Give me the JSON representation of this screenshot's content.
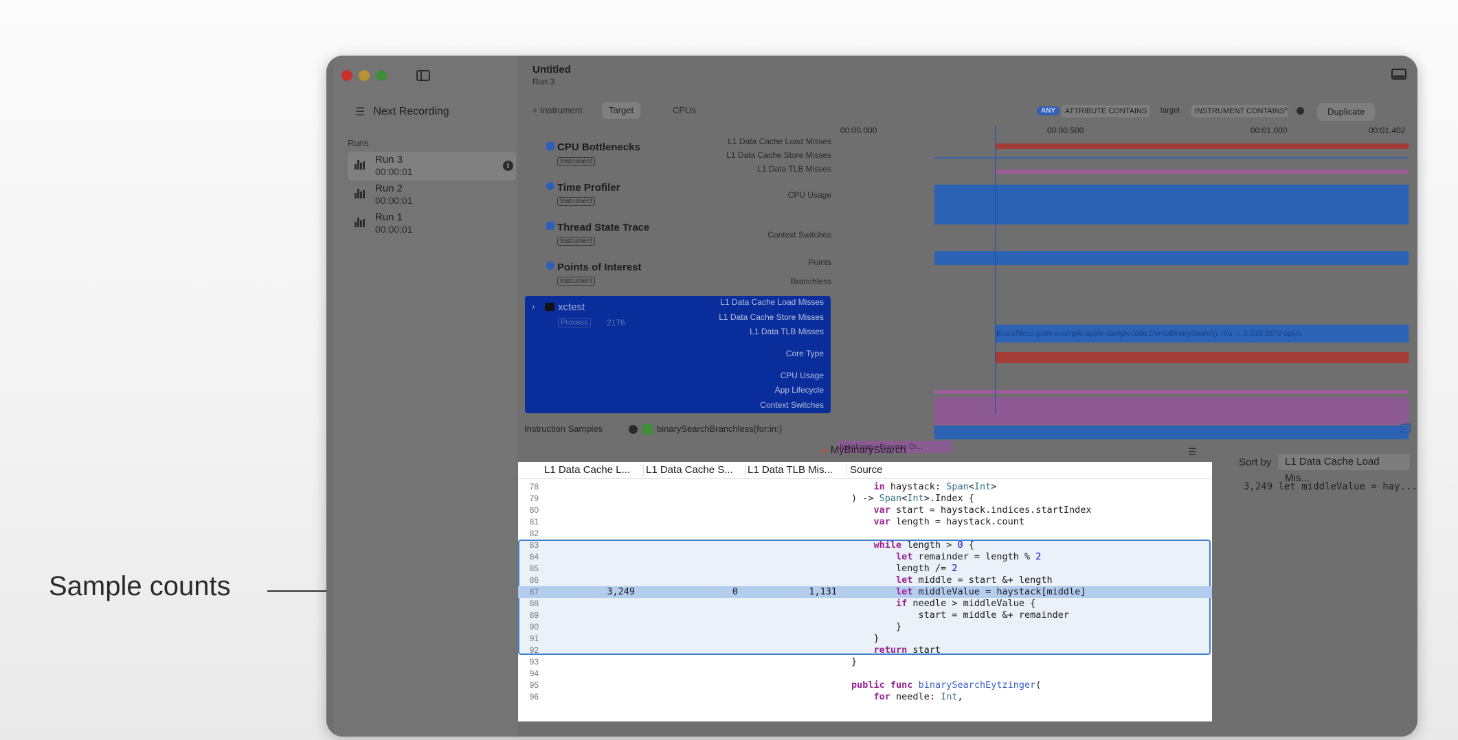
{
  "callout": {
    "label": "Sample counts"
  },
  "window": {
    "title": "Untitled",
    "subtitle": "Run 3"
  },
  "sidebar": {
    "next_recording": "Next Recording",
    "runs_label": "Runs",
    "runs": [
      {
        "name": "Run 3",
        "time": "00:00:01",
        "selected": true
      },
      {
        "name": "Run 2",
        "time": "00:00:01",
        "selected": false
      },
      {
        "name": "Run 1",
        "time": "00:00:01",
        "selected": false
      }
    ]
  },
  "toolbar": {
    "add_instrument": "+ Instrument",
    "target_tab": "Target",
    "cpus_tab": "CPUs",
    "filter_any": "ANY",
    "filter_attr": "ATTRIBUTE CONTAINS",
    "filter_target": "target",
    "filter_instr": "INSTRUMENT CONTAINS",
    "filter_star": "*",
    "duplicate": "Duplicate"
  },
  "ruler": [
    "00:00.000",
    "00:00.500",
    "00:01.000",
    "00:01.402"
  ],
  "tracks": [
    {
      "name": "CPU Bottlenecks",
      "tag": "Instrument",
      "labels": [
        "L1 Data Cache Load Misses",
        "L1 Data Cache Store Misses",
        "L1 Data TLB Misses"
      ]
    },
    {
      "name": "Time Profiler",
      "tag": "Instrument",
      "labels": [
        "CPU Usage"
      ]
    },
    {
      "name": "Thread State Trace",
      "tag": "Instrument",
      "labels": [
        "Context Switches"
      ]
    },
    {
      "name": "Points of Interest",
      "tag": "Instrument",
      "labels": [
        "Points",
        "Branchless"
      ]
    }
  ],
  "process": {
    "name": "xctest",
    "kind": "Process",
    "pid": "2176",
    "labels": [
      "L1 Data Cache Load Misses",
      "L1 Data Cache Store Misses",
      "L1 Data TLB Misses",
      "Core Type",
      "CPU Usage",
      "App Lifecycle",
      "Context Switches"
    ]
  },
  "graph": {
    "branchless_text": "Branchless (com.example.apple-samplecode.DemoBinarySearch): n/a → 2,039.2872 ops/s",
    "lifecycle_text": "Initializing - Process Cr..."
  },
  "detail": {
    "view": "Instruction Samples",
    "function": "binarySearchBranchless(for:in:)",
    "file": "MyBinarySearch"
  },
  "columns": [
    "L1 Data Cache L...",
    "L1 Data Cache S...",
    "L1 Data TLB Mis...",
    "Source"
  ],
  "source_rows": [
    {
      "ln": "78",
      "a": "",
      "b": "",
      "c": "",
      "src": "    in haystack: Span<Int>"
    },
    {
      "ln": "79",
      "a": "",
      "b": "",
      "c": "",
      "src": ") -> Span<Int>.Index {"
    },
    {
      "ln": "80",
      "a": "",
      "b": "",
      "c": "",
      "src": "    var start = haystack.indices.startIndex"
    },
    {
      "ln": "81",
      "a": "",
      "b": "",
      "c": "",
      "src": "    var length = haystack.count"
    },
    {
      "ln": "82",
      "a": "",
      "b": "",
      "c": "",
      "src": ""
    },
    {
      "ln": "83",
      "a": "",
      "b": "",
      "c": "",
      "src": "    while length > 0 {"
    },
    {
      "ln": "84",
      "a": "",
      "b": "",
      "c": "",
      "src": "        let remainder = length % 2"
    },
    {
      "ln": "85",
      "a": "",
      "b": "",
      "c": "",
      "src": "        length /= 2"
    },
    {
      "ln": "86",
      "a": "",
      "b": "",
      "c": "",
      "src": "        let middle = start &+ length"
    },
    {
      "ln": "87",
      "a": "3,249",
      "b": "0",
      "c": "1,131",
      "src": "        let middleValue = haystack[middle]",
      "hot": true
    },
    {
      "ln": "88",
      "a": "",
      "b": "",
      "c": "",
      "src": "        if needle > middleValue {"
    },
    {
      "ln": "89",
      "a": "",
      "b": "",
      "c": "",
      "src": "            start = middle &+ remainder"
    },
    {
      "ln": "90",
      "a": "",
      "b": "",
      "c": "",
      "src": "        }"
    },
    {
      "ln": "91",
      "a": "",
      "b": "",
      "c": "",
      "src": "    }"
    },
    {
      "ln": "92",
      "a": "",
      "b": "",
      "c": "",
      "src": "    return start"
    },
    {
      "ln": "93",
      "a": "",
      "b": "",
      "c": "",
      "src": "}"
    },
    {
      "ln": "94",
      "a": "",
      "b": "",
      "c": "",
      "src": ""
    },
    {
      "ln": "95",
      "a": "",
      "b": "",
      "c": "",
      "src": "public func binarySearchEytzinger("
    },
    {
      "ln": "96",
      "a": "",
      "b": "",
      "c": "",
      "src": "    for needle: Int,"
    }
  ],
  "sort": {
    "label": "Sort by",
    "value": "L1 Data Cache Load Mis...",
    "result": "3,249 let middleValue = hay..."
  },
  "colors": {
    "accent": "#2f5fb8",
    "process_selection": "#0a2d9c",
    "hot_row": "#b3cdef"
  }
}
